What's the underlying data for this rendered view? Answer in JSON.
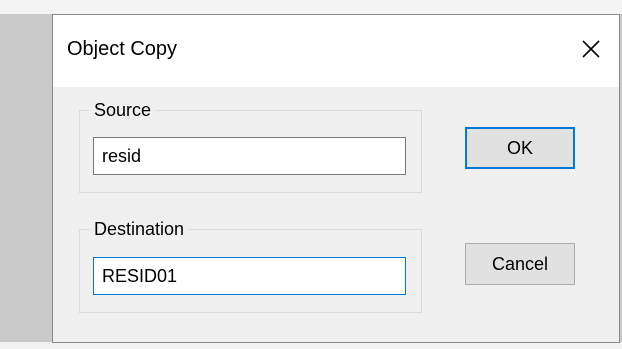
{
  "dialog": {
    "title": "Object Copy"
  },
  "source": {
    "label": "Source",
    "value": "resid"
  },
  "destination": {
    "label": "Destination",
    "value": "RESID01"
  },
  "buttons": {
    "ok_label": "OK",
    "cancel_label": "Cancel"
  },
  "icons": {
    "close": "close-icon"
  },
  "colors": {
    "focus_accent": "#0078d7",
    "dialog_background": "#f0f0f0",
    "titlebar_background": "#ffffff"
  }
}
